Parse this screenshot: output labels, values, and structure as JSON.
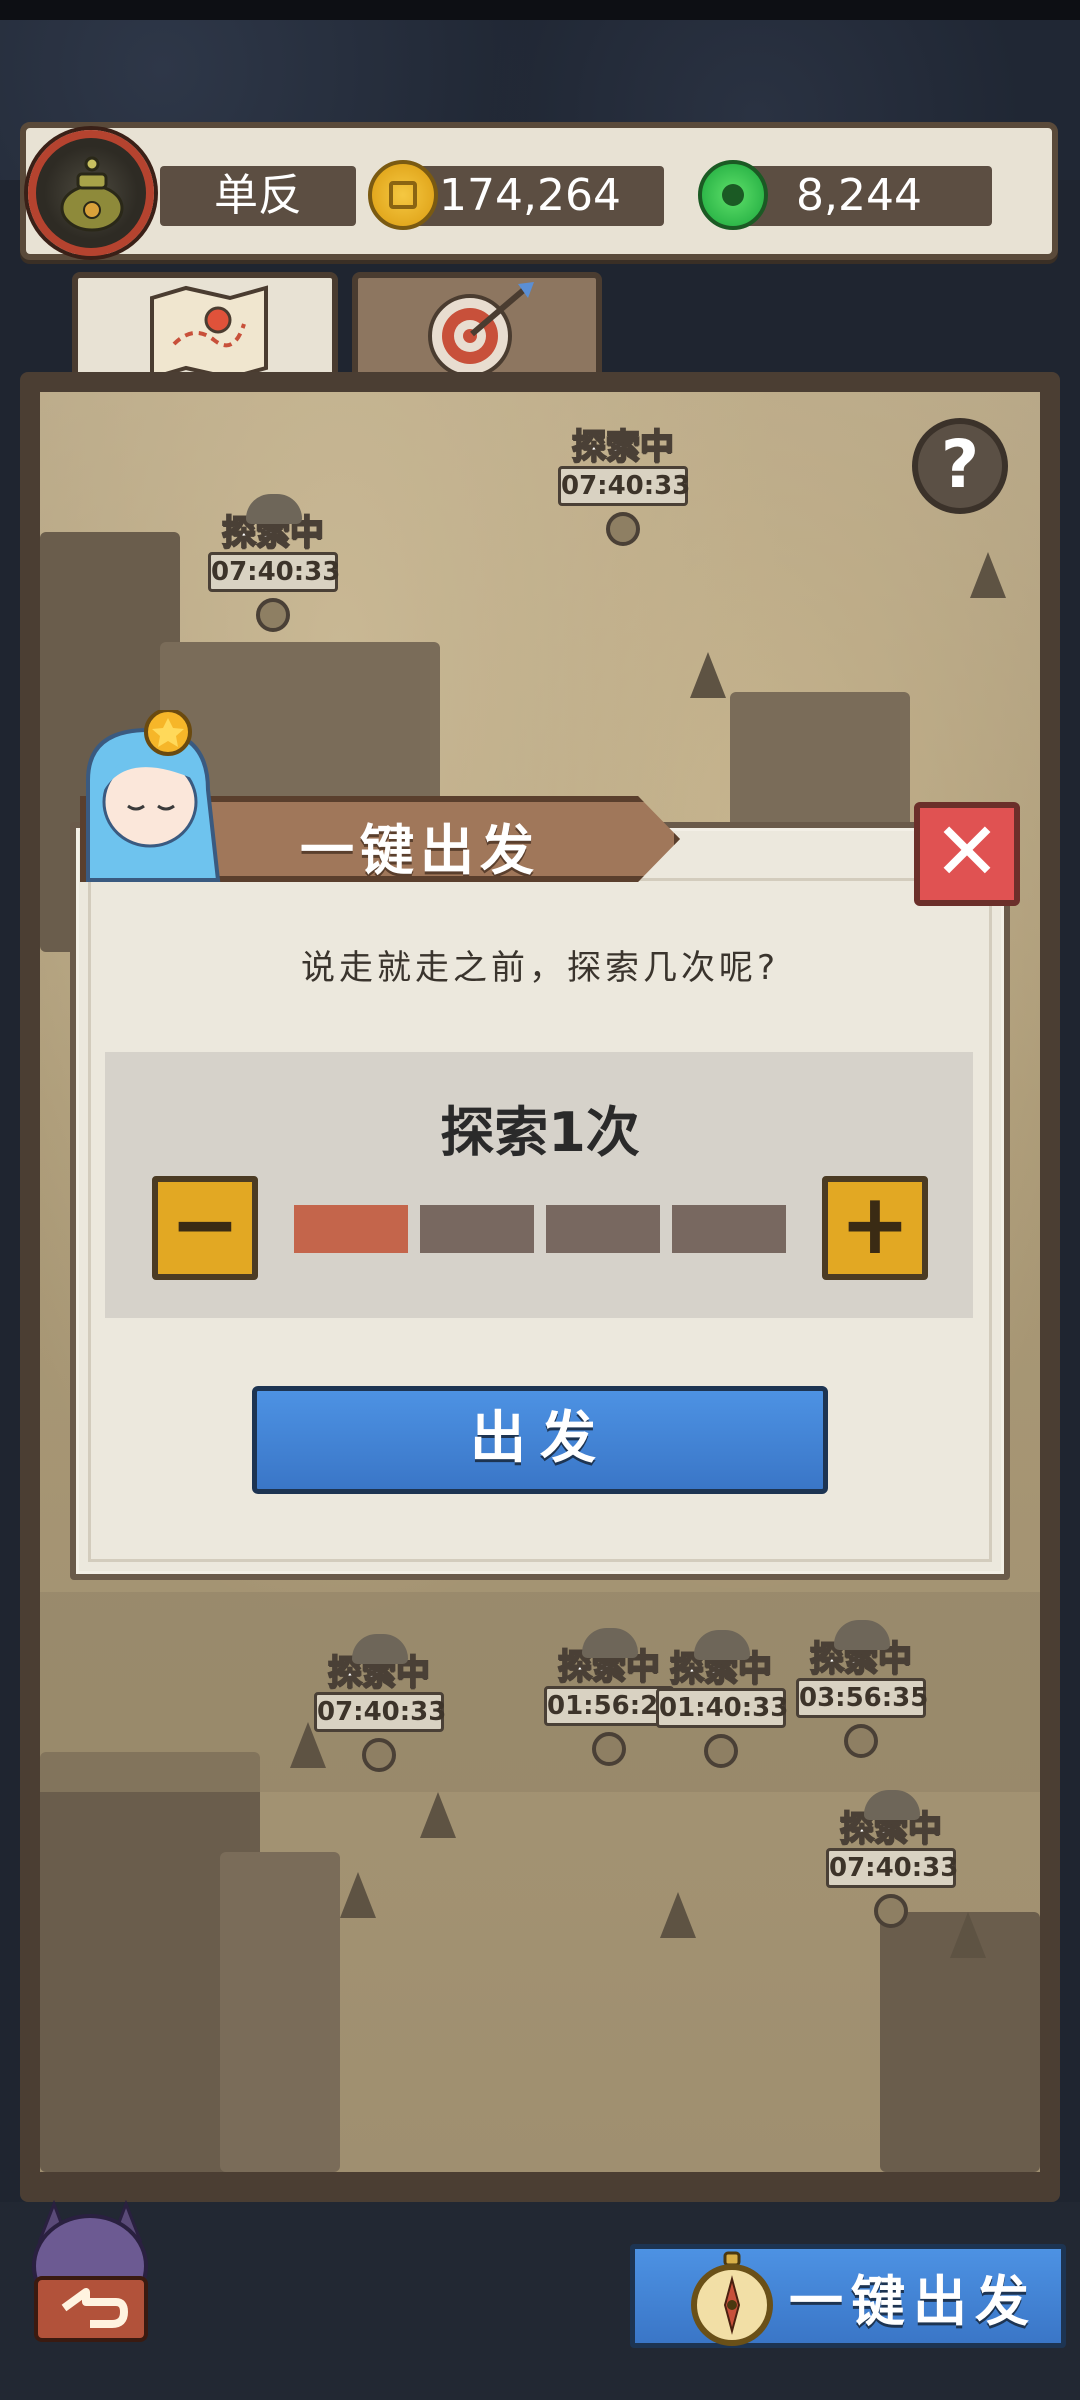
{
  "resources": {
    "player_name": "单反",
    "coins": "174,264",
    "jade": "8,244"
  },
  "map": {
    "help_glyph": "?",
    "markers": [
      {
        "status": "探索中",
        "time": "07:40:33"
      },
      {
        "status": "探索中",
        "time": "07:40:33"
      },
      {
        "status": "探索中",
        "time": "07:40:33"
      },
      {
        "status": "探索中",
        "time": "01:56:28"
      },
      {
        "status": "探索中",
        "time": "01:40:33"
      },
      {
        "status": "探索中",
        "time": "03:56:35"
      },
      {
        "status": "探索中",
        "time": "07:40:33"
      }
    ]
  },
  "dialog": {
    "title": "一键出发",
    "close_glyph": "✕",
    "question": "说走就走之前，探索几次呢?",
    "count_label": "探索1次",
    "minus_glyph": "−",
    "plus_glyph": "+",
    "count_value": 1,
    "count_max": 4,
    "depart_label": "出发"
  },
  "footer": {
    "depart_all_label": "一键出发"
  },
  "colors": {
    "segment_active": "#c4654b",
    "segment_inactive": "#786860",
    "accent_blue": "#4d92e3",
    "accent_yellow": "#e2a823",
    "close_red": "#e05252"
  }
}
